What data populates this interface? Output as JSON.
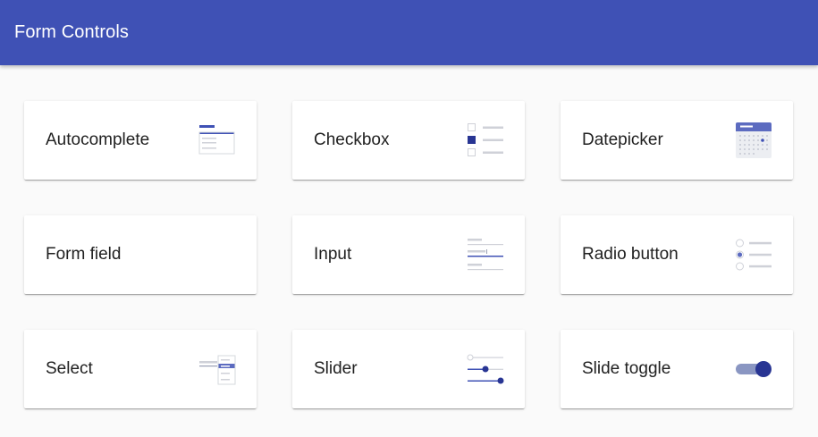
{
  "header": {
    "title": "Form Controls"
  },
  "theme": {
    "primary": "#3f51b5",
    "dark": "#283593",
    "light_gray": "#cfd1d8"
  },
  "cards": [
    {
      "label": "Autocomplete",
      "icon": "autocomplete-icon"
    },
    {
      "label": "Checkbox",
      "icon": "checkbox-icon"
    },
    {
      "label": "Datepicker",
      "icon": "datepicker-icon"
    },
    {
      "label": "Form field",
      "icon": ""
    },
    {
      "label": "Input",
      "icon": "input-icon"
    },
    {
      "label": "Radio button",
      "icon": "radio-button-icon"
    },
    {
      "label": "Select",
      "icon": "select-icon"
    },
    {
      "label": "Slider",
      "icon": "slider-icon"
    },
    {
      "label": "Slide toggle",
      "icon": "slide-toggle-icon"
    }
  ]
}
